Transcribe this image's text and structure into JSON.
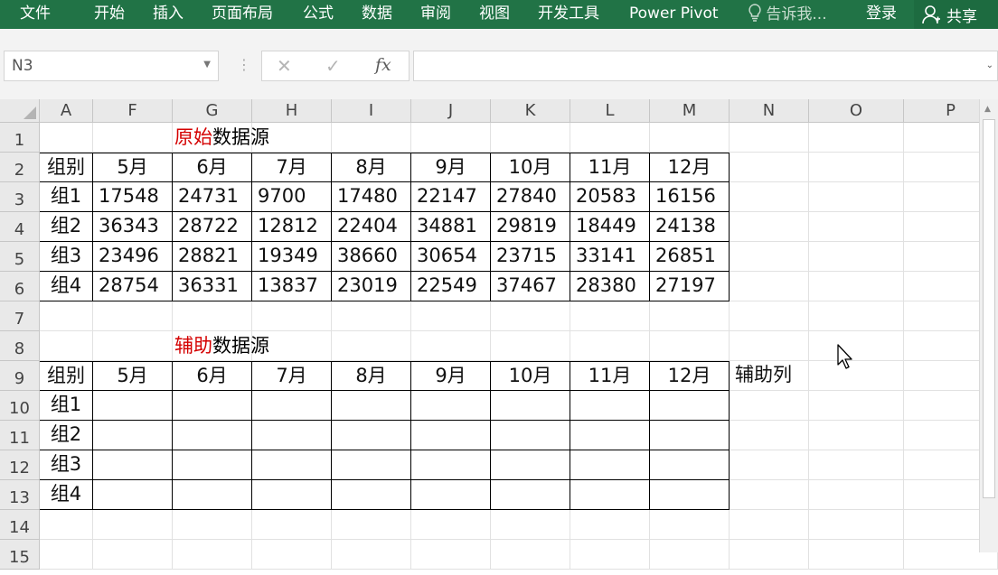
{
  "ribbon": {
    "tabs": [
      "文件",
      "开始",
      "插入",
      "页面布局",
      "公式",
      "数据",
      "审阅",
      "视图",
      "开发工具",
      "Power Pivot"
    ],
    "tell_me": "告诉我...",
    "login": "登录",
    "share": "共享",
    "colors": {
      "ribbon": "#217346"
    }
  },
  "formula_bar": {
    "name_box": "N3",
    "cancel_icon": "✕",
    "enter_icon": "✓",
    "fx_label": "fx",
    "formula": ""
  },
  "sheet": {
    "columns": [
      "A",
      "F",
      "G",
      "H",
      "I",
      "J",
      "K",
      "L",
      "M",
      "N",
      "O",
      "P"
    ],
    "rows": [
      "1",
      "2",
      "3",
      "4",
      "5",
      "6",
      "7",
      "8",
      "9",
      "10",
      "11",
      "12",
      "13",
      "14",
      "15"
    ],
    "title1_red": "原始",
    "title1_black": "数据源",
    "title2_red": "辅助",
    "title2_black": "数据源",
    "header_label": "组别",
    "months": [
      "5月",
      "6月",
      "7月",
      "8月",
      "9月",
      "10月",
      "11月",
      "12月"
    ],
    "groups": [
      "组1",
      "组2",
      "组3",
      "组4"
    ],
    "data": [
      [
        "17548",
        "24731",
        "9700",
        "17480",
        "22147",
        "27840",
        "20583",
        "16156"
      ],
      [
        "36343",
        "28722",
        "12812",
        "22404",
        "34881",
        "29819",
        "18449",
        "24138"
      ],
      [
        "23496",
        "28821",
        "19349",
        "38660",
        "30654",
        "23715",
        "33141",
        "26851"
      ],
      [
        "28754",
        "36331",
        "13837",
        "23019",
        "22549",
        "37467",
        "28380",
        "27197"
      ]
    ],
    "helper_column": "辅助列",
    "selected_cell": "N3"
  }
}
